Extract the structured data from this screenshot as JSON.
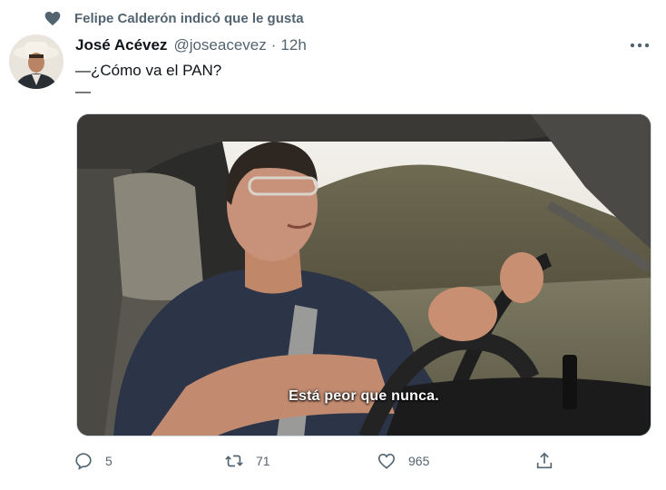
{
  "social_context": {
    "text": "Felipe Calderón indicó que le gusta",
    "icon": "heart-icon"
  },
  "author": {
    "name": "José Acévez",
    "handle": "@joseacevez",
    "separator": "·",
    "time": "12h"
  },
  "tweet": {
    "line1": "—¿Cómo va el PAN?",
    "line2": "—"
  },
  "media": {
    "subtitle": "Está peor que nunca."
  },
  "actions": {
    "replies": "5",
    "retweets": "71",
    "likes": "965"
  },
  "colors": {
    "secondary_text": "#536471",
    "primary_text": "#0f1419",
    "border": "#cfd9de"
  }
}
